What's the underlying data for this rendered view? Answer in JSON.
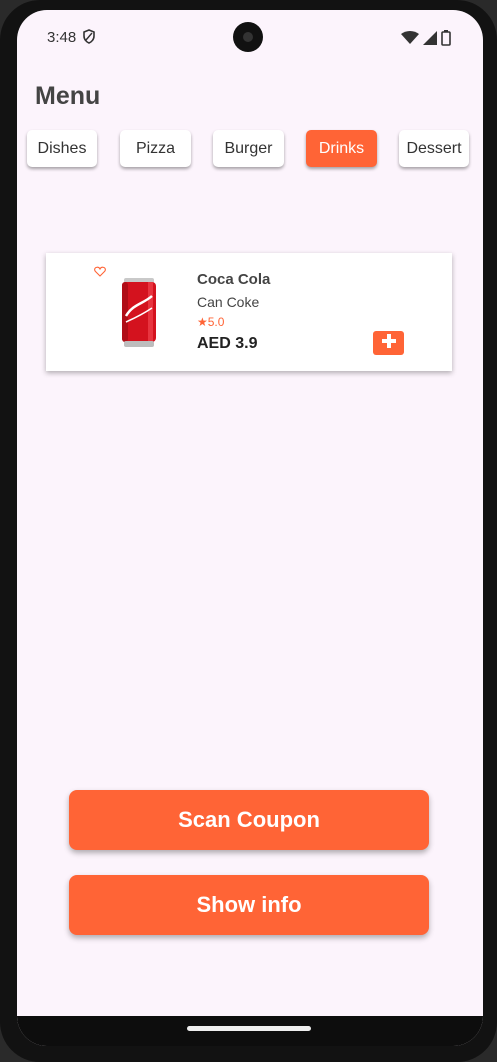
{
  "status_bar": {
    "time": "3:48"
  },
  "page": {
    "title": "Menu"
  },
  "tabs": [
    {
      "label": "Dishes",
      "active": false
    },
    {
      "label": "Pizza",
      "active": false
    },
    {
      "label": "Burger",
      "active": false
    },
    {
      "label": "Drinks",
      "active": true
    },
    {
      "label": "Dessert",
      "active": false
    }
  ],
  "item": {
    "name": "Coca Cola",
    "description": "Can Coke",
    "rating": "★5.0",
    "price": "AED 3.9",
    "icons": {
      "favorite": "heart-outline-icon",
      "add": "plus-icon"
    }
  },
  "buttons": {
    "scan_coupon": "Scan Coupon",
    "show_info": "Show info"
  },
  "colors": {
    "accent": "#ff6436",
    "background": "#fcf4fc"
  }
}
